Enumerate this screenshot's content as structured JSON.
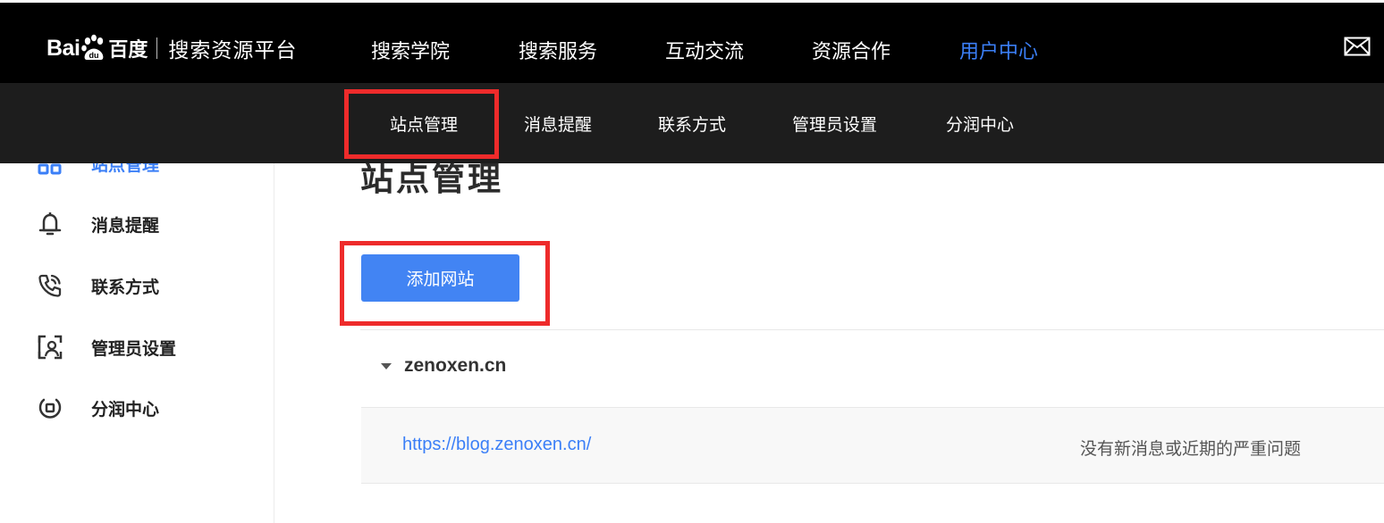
{
  "brand": {
    "logo_text_latin": "Bai",
    "logo_text_du": "du",
    "logo_text_cn": "百度",
    "platform_title": "搜索资源平台"
  },
  "top_nav": {
    "items": [
      {
        "label": "搜索学院",
        "active": false
      },
      {
        "label": "搜索服务",
        "active": false
      },
      {
        "label": "互动交流",
        "active": false
      },
      {
        "label": "资源合作",
        "active": false
      },
      {
        "label": "用户中心",
        "active": true
      }
    ],
    "mail_icon": "mail-icon"
  },
  "sub_nav": {
    "items": [
      {
        "label": "站点管理",
        "highlighted": true
      },
      {
        "label": "消息提醒"
      },
      {
        "label": "联系方式"
      },
      {
        "label": "管理员设置"
      },
      {
        "label": "分润中心"
      }
    ]
  },
  "sidebar": {
    "items": [
      {
        "label": "站点管理",
        "icon": "site-grid-icon",
        "active": true
      },
      {
        "label": "消息提醒",
        "icon": "bell-icon"
      },
      {
        "label": "联系方式",
        "icon": "phone-icon"
      },
      {
        "label": "管理员设置",
        "icon": "admin-user-icon"
      },
      {
        "label": "分润中心",
        "icon": "revenue-icon"
      }
    ]
  },
  "main": {
    "page_title": "站点管理",
    "add_button_label": "添加网站",
    "site_group": {
      "name": "zenoxen.cn",
      "sites": [
        {
          "url": "https://blog.zenoxen.cn/",
          "status": "没有新消息或近期的严重问题"
        }
      ]
    }
  },
  "colors": {
    "accent": "#3b7ff7",
    "button": "#4284f3",
    "annotation": "#ee2b2b",
    "topbar": "#000000",
    "subbar": "#1d1d1d"
  }
}
